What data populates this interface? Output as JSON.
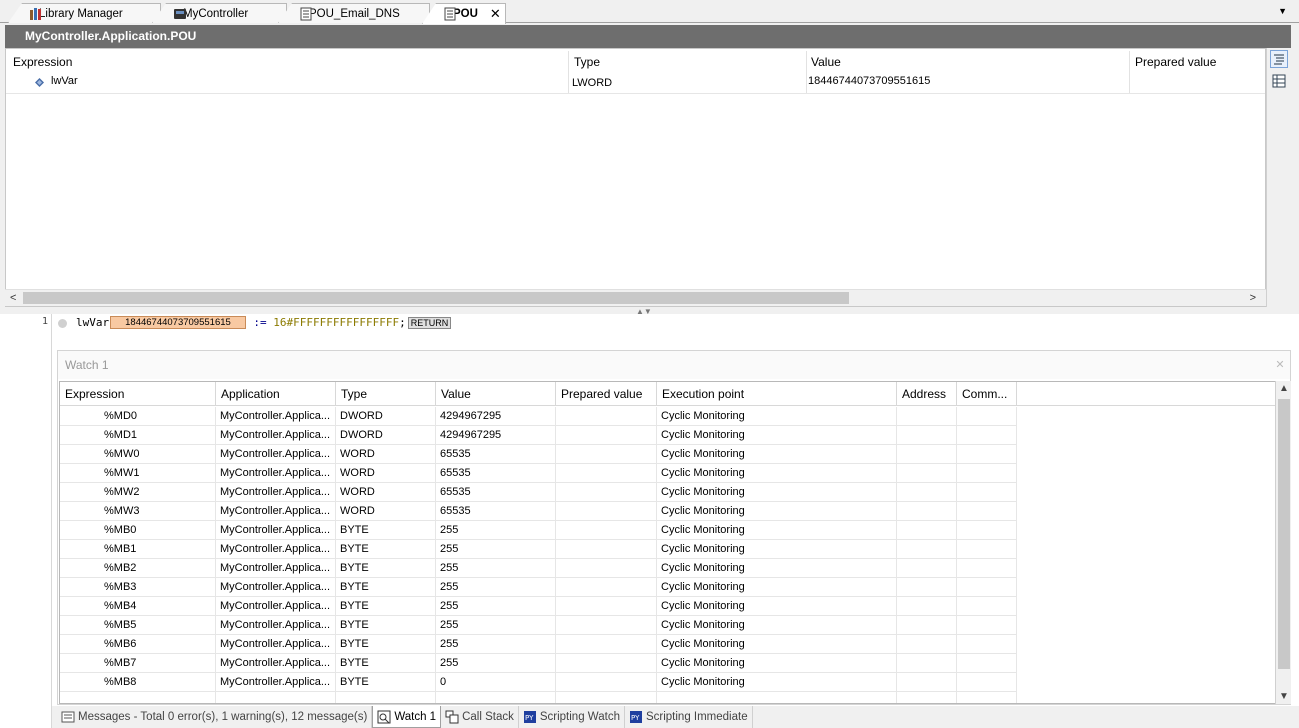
{
  "tabs": [
    {
      "label": "Library Manager",
      "icon": "library-icon"
    },
    {
      "label": "MyController",
      "icon": "controller-icon"
    },
    {
      "label": "POU_Email_DNS",
      "icon": "document-icon"
    },
    {
      "label": "POU",
      "icon": "document-icon",
      "close": "✕"
    }
  ],
  "doc_title": "MyController.Application.POU",
  "decl": {
    "headers": [
      "Expression",
      "Type",
      "Value",
      "Prepared value"
    ],
    "row": {
      "expression": "lwVar",
      "type": "LWORD",
      "value": "18446744073709551615"
    }
  },
  "code": {
    "line_number": "1",
    "var": "lwVar",
    "inline_value": "18446744073709551615",
    "op": ":=",
    "literal": "16#FFFFFFFFFFFFFFFF",
    "semicolon": ";",
    "return_label": "RETURN"
  },
  "watch": {
    "title": "Watch 1",
    "headers": [
      "Expression",
      "Application",
      "Type",
      "Value",
      "Prepared value",
      "Execution point",
      "Address",
      "Comm..."
    ],
    "rows": [
      {
        "expr": "%MD0",
        "app": "MyController.Applica...",
        "type": "DWORD",
        "value": "4294967295",
        "exec": "Cyclic Monitoring"
      },
      {
        "expr": "%MD1",
        "app": "MyController.Applica...",
        "type": "DWORD",
        "value": "4294967295",
        "exec": "Cyclic Monitoring"
      },
      {
        "expr": "%MW0",
        "app": "MyController.Applica...",
        "type": "WORD",
        "value": "65535",
        "exec": "Cyclic Monitoring"
      },
      {
        "expr": "%MW1",
        "app": "MyController.Applica...",
        "type": "WORD",
        "value": "65535",
        "exec": "Cyclic Monitoring"
      },
      {
        "expr": "%MW2",
        "app": "MyController.Applica...",
        "type": "WORD",
        "value": "65535",
        "exec": "Cyclic Monitoring"
      },
      {
        "expr": "%MW3",
        "app": "MyController.Applica...",
        "type": "WORD",
        "value": "65535",
        "exec": "Cyclic Monitoring"
      },
      {
        "expr": "%MB0",
        "app": "MyController.Applica...",
        "type": "BYTE",
        "value": "255",
        "exec": "Cyclic Monitoring"
      },
      {
        "expr": "%MB1",
        "app": "MyController.Applica...",
        "type": "BYTE",
        "value": "255",
        "exec": "Cyclic Monitoring"
      },
      {
        "expr": "%MB2",
        "app": "MyController.Applica...",
        "type": "BYTE",
        "value": "255",
        "exec": "Cyclic Monitoring"
      },
      {
        "expr": "%MB3",
        "app": "MyController.Applica...",
        "type": "BYTE",
        "value": "255",
        "exec": "Cyclic Monitoring"
      },
      {
        "expr": "%MB4",
        "app": "MyController.Applica...",
        "type": "BYTE",
        "value": "255",
        "exec": "Cyclic Monitoring"
      },
      {
        "expr": "%MB5",
        "app": "MyController.Applica...",
        "type": "BYTE",
        "value": "255",
        "exec": "Cyclic Monitoring"
      },
      {
        "expr": "%MB6",
        "app": "MyController.Applica...",
        "type": "BYTE",
        "value": "255",
        "exec": "Cyclic Monitoring"
      },
      {
        "expr": "%MB7",
        "app": "MyController.Applica...",
        "type": "BYTE",
        "value": "255",
        "exec": "Cyclic Monitoring"
      },
      {
        "expr": "%MB8",
        "app": "MyController.Applica...",
        "type": "BYTE",
        "value": "0",
        "exec": "Cyclic Monitoring"
      }
    ]
  },
  "bottom_tabs": [
    {
      "label": "Messages - Total 0 error(s), 1 warning(s), 12 message(s)",
      "icon": "messages-icon"
    },
    {
      "label": "Watch 1",
      "icon": "watch-icon",
      "active": true
    },
    {
      "label": "Call Stack",
      "icon": "call-stack-icon"
    },
    {
      "label": "Scripting Watch",
      "icon": "scripting-watch-icon"
    },
    {
      "label": "Scripting Immediate",
      "icon": "scripting-immediate-icon"
    }
  ]
}
